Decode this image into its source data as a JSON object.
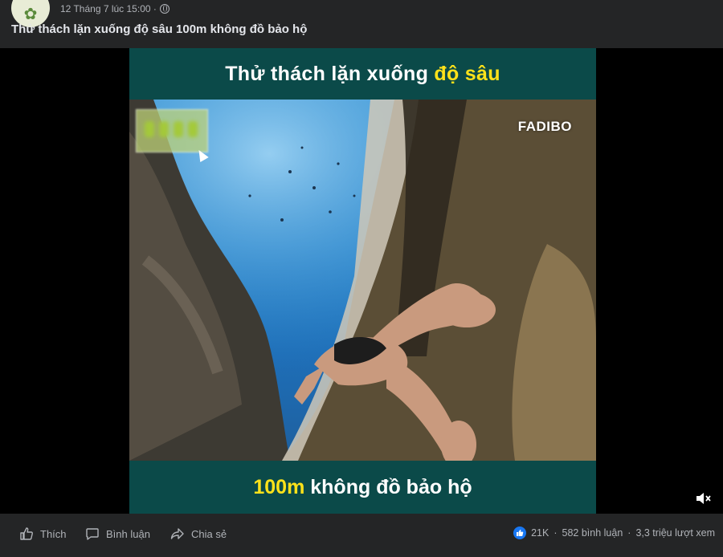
{
  "post": {
    "timestamp": "12 Tháng 7 lúc 15:00 ·",
    "text": "Thử thách lặn xuống độ sâu 100m không đồ bảo hộ",
    "avatar_icon": "clover-icon"
  },
  "video": {
    "top_caption_plain": "Thử thách lặn xuống ",
    "top_caption_highlight": "độ sâu",
    "bottom_caption_highlight": "100m",
    "bottom_caption_plain": " không đồ bảo hộ",
    "watermark": "FADIBO",
    "highlight_color": "#ffe21a",
    "banner_color": "#0b4a49"
  },
  "actions": {
    "like": "Thích",
    "comment": "Bình luận",
    "share": "Chia sẻ"
  },
  "stats": {
    "likes": "21K",
    "comments": "582 bình luận",
    "views": "3,3 triệu lượt xem",
    "separator": "·"
  }
}
